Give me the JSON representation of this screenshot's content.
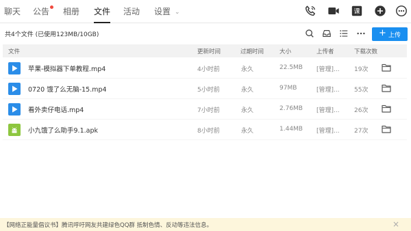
{
  "nav": {
    "tabs": [
      {
        "label": "聊天"
      },
      {
        "label": "公告",
        "badge": true
      },
      {
        "label": "相册"
      },
      {
        "label": "文件",
        "active": true
      },
      {
        "label": "活动"
      },
      {
        "label": "设置"
      }
    ],
    "icons": [
      "phone-icon",
      "video-icon",
      "classroom-icon",
      "add-icon",
      "more-icon"
    ],
    "classroom_glyph": "课"
  },
  "toolbar": {
    "summary": "共4个文件 (已使用123MB/10GB)",
    "icons": [
      "search-icon",
      "inbox-icon",
      "list-icon",
      "more-icon"
    ],
    "upload_label": "上传",
    "upload_color": "#1a8ff0"
  },
  "table": {
    "headers": {
      "name": "文件",
      "updated": "更新时间",
      "expire": "过期时间",
      "size": "大小",
      "uploader": "上传者",
      "downloads": "下载次数"
    },
    "rows": [
      {
        "type": "mp4",
        "name": "苹果-模拟器下单教程.mp4",
        "updated": "4小时前",
        "expire": "永久",
        "size": "22.5MB",
        "uploader": "[管理]...",
        "downloads": "19次"
      },
      {
        "type": "mp4",
        "name": "0720 饿了么无脑-15.mp4",
        "updated": "5小时前",
        "expire": "永久",
        "size": "97MB",
        "uploader": "[管理]...",
        "downloads": "55次"
      },
      {
        "type": "mp4",
        "name": "看外卖仔电话.mp4",
        "updated": "7小时前",
        "expire": "永久",
        "size": "2.76MB",
        "uploader": "[管理]...",
        "downloads": "26次"
      },
      {
        "type": "apk",
        "name": "小九饿了么助手9.1.apk",
        "updated": "8小时前",
        "expire": "永久",
        "size": "1.44MB",
        "uploader": "[管理]...",
        "downloads": "27次"
      }
    ]
  },
  "notice": {
    "text": "【网络正能量倡议书】腾讯呼吁网友共建绿色QQ群 抵制色情、反动等违法信息。",
    "background": "#fdf6dc"
  }
}
